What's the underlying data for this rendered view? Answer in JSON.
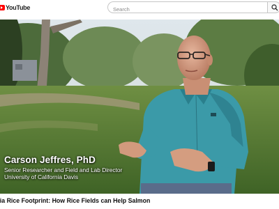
{
  "header": {
    "logo_text": "YouTube",
    "logo_icon": "youtube-play-icon",
    "brand_color": "#ff0000",
    "search": {
      "placeholder": "Search",
      "value": ""
    },
    "search_icon": "search-icon"
  },
  "video": {
    "lower_third": {
      "name": "Carson Jeffres, PhD",
      "role": "Senior Researcher and Field and Lab Director",
      "organization": "University of California Davis"
    }
  },
  "title": {
    "text": "rnia Rice Footprint: How Rice Fields can Help Salmon"
  }
}
